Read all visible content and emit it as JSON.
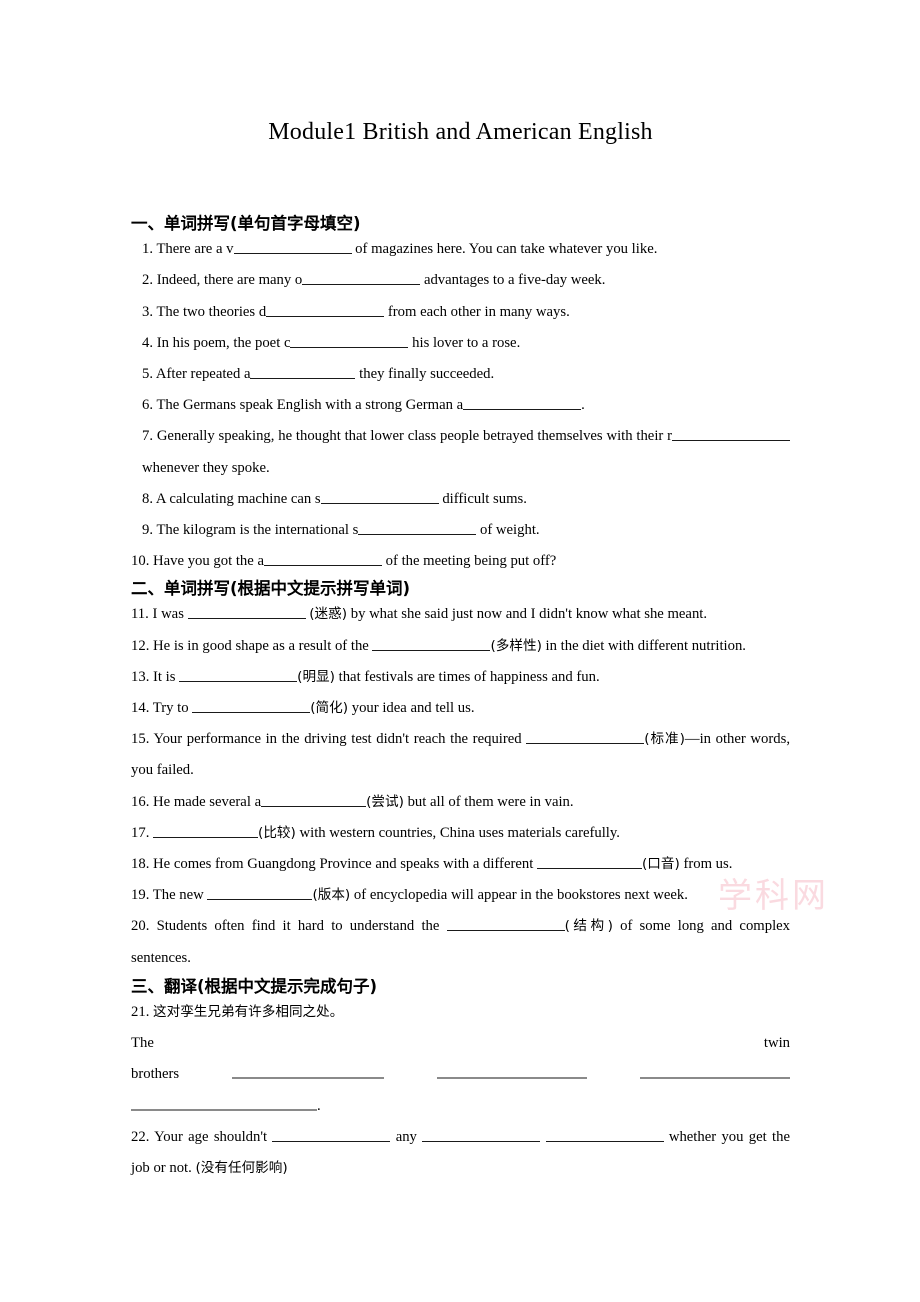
{
  "document": {
    "title": "Module1 British and American English"
  },
  "watermark": {
    "text": "学科网"
  },
  "sections": [
    {
      "heading": "一、单词拼写(单句首字母填空)",
      "items": [
        {
          "number": "1.",
          "pre": "There are a v",
          "post": " of magazines here. You can take whatever you like."
        },
        {
          "number": "2.",
          "pre": "Indeed, there are many o",
          "post": " advantages to a five-day week."
        },
        {
          "number": "3.",
          "pre": "The two theories d",
          "post": " from each other in many ways."
        },
        {
          "number": "4.",
          "pre": "In his poem, the poet c",
          "post": " his lover to a rose."
        },
        {
          "number": "5.",
          "pre": "After repeated a",
          "post": " they finally succeeded."
        },
        {
          "number": "6.",
          "pre": "The Germans speak English with a strong German a",
          "post": "."
        },
        {
          "number": "7.",
          "pre": "Generally speaking, he thought that lower class people betrayed themselves with their r",
          "post": " whenever they spoke."
        },
        {
          "number": "8.",
          "pre": "A calculating machine can s",
          "post": " difficult sums."
        },
        {
          "number": "9.",
          "pre": "The kilogram is the international s",
          "post": " of weight."
        },
        {
          "number": "10.",
          "pre": "Have you got the a",
          "post": " of the meeting being put off?"
        }
      ]
    },
    {
      "heading": "二、单词拼写(根据中文提示拼写单词)",
      "items": [
        {
          "number": "11.",
          "pre": "I was ",
          "hint": "(迷惑)",
          "post": " by what she said just now and I didn't know what she meant."
        },
        {
          "number": "12.",
          "pre": "He is in good shape as a result of the ",
          "hint": "(多样性)",
          "post": " in the diet with different nutrition."
        },
        {
          "number": "13.",
          "pre": "It is ",
          "hint": "(明显)",
          "post": " that festivals are times of happiness and fun."
        },
        {
          "number": "14.",
          "pre": "Try to ",
          "hint": "(简化)",
          "post": " your idea and tell us."
        },
        {
          "number": "15.",
          "pre": "Your performance in the driving test didn't reach the required ",
          "hint": "(标准)",
          "post": "—in other words, you failed."
        },
        {
          "number": "16.",
          "pre": "He made several a",
          "hint": "(尝试)",
          "post": " but all of them were in vain."
        },
        {
          "number": "17.",
          "pre": " ",
          "hint": "(比较)",
          "post": " with western countries, China uses materials carefully."
        },
        {
          "number": "18.",
          "pre": "He comes from Guangdong Province and speaks with a different ",
          "hint": "(口音)",
          "post": " from us."
        },
        {
          "number": "19.",
          "pre": "The new ",
          "hint": "(版本)",
          "post": " of encyclopedia will appear in the bookstores next week."
        },
        {
          "number": "20.",
          "pre": "Students often find it hard to understand the ",
          "hint": "(结构)",
          "post": " of some long and complex sentences."
        }
      ]
    },
    {
      "heading": "三、翻译(根据中文提示完成句子)",
      "items": [
        {
          "number": "21.",
          "prompt": "这对孪生兄弟有许多相同之处。",
          "answer_left": "The",
          "answer_right": "twin",
          "answer_line2_lead": "brothers",
          "answer_tail": "."
        },
        {
          "number": "22.",
          "pre": "Your age shouldn't ",
          "mid1": " any ",
          "mid2": " ",
          "post": " whether you get the job or not. ",
          "hint": "(没有任何影响)"
        }
      ]
    }
  ]
}
